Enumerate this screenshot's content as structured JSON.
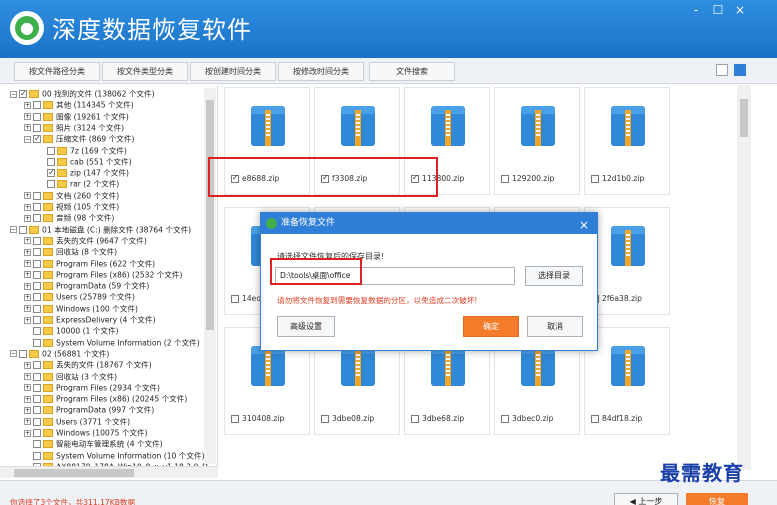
{
  "app": {
    "title": "深度数据恢复软件",
    "window_controls": [
      "-",
      "☐",
      "×"
    ]
  },
  "tabs": [
    {
      "label": "按文件路径分类"
    },
    {
      "label": "按文件类型分类"
    },
    {
      "label": "按创建时间分类"
    },
    {
      "label": "按修改时间分类"
    },
    {
      "label": "文件搜索"
    }
  ],
  "view_icons": [
    "list-view-icon",
    "grid-view-icon"
  ],
  "tree": {
    "rows": [
      {
        "indent": 0,
        "exp": "−",
        "checked": true,
        "folder": true,
        "label": "00 找到的文件 (138062 个文件)"
      },
      {
        "indent": 1,
        "exp": "+",
        "checked": false,
        "folder": true,
        "label": "其他  (114345 个文件)"
      },
      {
        "indent": 1,
        "exp": "+",
        "checked": false,
        "folder": true,
        "label": "图像  (19261 个文件)"
      },
      {
        "indent": 1,
        "exp": "+",
        "checked": false,
        "folder": true,
        "label": "照片  (3124 个文件)"
      },
      {
        "indent": 1,
        "exp": "−",
        "checked": true,
        "folder": true,
        "label": "压缩文件  (869 个文件)"
      },
      {
        "indent": 2,
        "exp": "",
        "checked": false,
        "folder": true,
        "label": "7z  (169 个文件)"
      },
      {
        "indent": 2,
        "exp": "",
        "checked": false,
        "folder": true,
        "label": "cab  (551 个文件)"
      },
      {
        "indent": 2,
        "exp": "",
        "checked": true,
        "folder": true,
        "label": "zip  (147 个文件)"
      },
      {
        "indent": 2,
        "exp": "",
        "checked": false,
        "folder": true,
        "label": "rar  (2 个文件)"
      },
      {
        "indent": 1,
        "exp": "+",
        "checked": false,
        "folder": true,
        "label": "文档  (260 个文件)"
      },
      {
        "indent": 1,
        "exp": "+",
        "checked": false,
        "folder": true,
        "label": "视频  (105 个文件)"
      },
      {
        "indent": 1,
        "exp": "+",
        "checked": false,
        "folder": true,
        "label": "音频  (98 个文件)"
      },
      {
        "indent": 0,
        "exp": "−",
        "checked": false,
        "folder": true,
        "label": "01 本地磁盘 (C:) 删除文件 (38764 个文件)"
      },
      {
        "indent": 1,
        "exp": "+",
        "checked": false,
        "folder": true,
        "label": "丢失的文件  (9647 个文件)"
      },
      {
        "indent": 1,
        "exp": "+",
        "checked": false,
        "folder": true,
        "label": "回收站  (8 个文件)"
      },
      {
        "indent": 1,
        "exp": "+",
        "checked": false,
        "folder": true,
        "label": "Program Files  (622 个文件)"
      },
      {
        "indent": 1,
        "exp": "+",
        "checked": false,
        "folder": true,
        "label": "Program Files (x86)  (2532 个文件)"
      },
      {
        "indent": 1,
        "exp": "+",
        "checked": false,
        "folder": true,
        "label": "ProgramData  (59 个文件)"
      },
      {
        "indent": 1,
        "exp": "+",
        "checked": false,
        "folder": true,
        "label": "Users  (25789 个文件)"
      },
      {
        "indent": 1,
        "exp": "+",
        "checked": false,
        "folder": true,
        "label": "Windows  (100 个文件)"
      },
      {
        "indent": 1,
        "exp": "+",
        "checked": false,
        "folder": true,
        "label": "ExpressDelivery  (4 个文件)"
      },
      {
        "indent": 1,
        "exp": "",
        "checked": false,
        "folder": true,
        "label": "10000  (1 个文件)"
      },
      {
        "indent": 1,
        "exp": "",
        "checked": false,
        "folder": true,
        "label": "System Volume Information  (2 个文件)"
      },
      {
        "indent": 0,
        "exp": "−",
        "checked": false,
        "folder": true,
        "label": "02  (56881 个文件)"
      },
      {
        "indent": 1,
        "exp": "+",
        "checked": false,
        "folder": true,
        "label": "丢失的文件  (18767 个文件)"
      },
      {
        "indent": 1,
        "exp": "+",
        "checked": false,
        "folder": true,
        "label": "回收站  (3 个文件)"
      },
      {
        "indent": 1,
        "exp": "+",
        "checked": false,
        "folder": true,
        "label": "Program Files  (2934 个文件)"
      },
      {
        "indent": 1,
        "exp": "+",
        "checked": false,
        "folder": true,
        "label": "Program Files (x86)  (20245 个文件)"
      },
      {
        "indent": 1,
        "exp": "+",
        "checked": false,
        "folder": true,
        "label": "ProgramData  (997 个文件)"
      },
      {
        "indent": 1,
        "exp": "+",
        "checked": false,
        "folder": true,
        "label": "Users  (3771 个文件)"
      },
      {
        "indent": 1,
        "exp": "+",
        "checked": false,
        "folder": true,
        "label": "Windows  (10075 个文件)"
      },
      {
        "indent": 1,
        "exp": "",
        "checked": false,
        "folder": true,
        "label": "智能电动车管理系统  (4 个文件)"
      },
      {
        "indent": 1,
        "exp": "",
        "checked": false,
        "folder": true,
        "label": "System Volume Information  (10 个文件)"
      },
      {
        "indent": 1,
        "exp": "",
        "checked": false,
        "folder": true,
        "label": "AX88179_178A_Win10_8_x_v1.18.2.0_D..."
      }
    ]
  },
  "files": [
    {
      "name": "e8688.zip",
      "checked": true
    },
    {
      "name": "f3308.zip",
      "checked": true
    },
    {
      "name": "113800.zip",
      "checked": true
    },
    {
      "name": "129200.zip",
      "checked": false
    },
    {
      "name": "12d1b0.zip",
      "checked": false
    },
    {
      "name": "14ed...",
      "checked": false
    },
    {
      "name": "",
      "checked": false
    },
    {
      "name": "",
      "checked": false
    },
    {
      "name": "",
      "checked": false
    },
    {
      "name": "2f6a38.zip",
      "checked": false
    },
    {
      "name": "310408.zip",
      "checked": false
    },
    {
      "name": "3dbe08.zip",
      "checked": false
    },
    {
      "name": "3dbe68.zip",
      "checked": false
    },
    {
      "name": "3dbec0.zip",
      "checked": false
    },
    {
      "name": "84df18.zip",
      "checked": false
    }
  ],
  "dialog": {
    "title": "准备恢复文件",
    "close": "×",
    "prompt": "请选择文件恢复后的保存目录!",
    "path_value": "D:\\tools\\桌面\\office",
    "browse_label": "选择目录",
    "warning": "请勿将文件恢复到需要恢复数据的分区，以免造成二次破坏!",
    "advanced_label": "高级设置",
    "ok_label": "确定",
    "cancel_label": "取消"
  },
  "footer": {
    "status": "你选择了3个文件，共311.17KB数据",
    "prev_label": "◀ 上一步",
    "recover_label": "恢复"
  },
  "watermark": "最需教育",
  "colors": {
    "titlebar": "#2f8ee0",
    "accent": "#2f7fd8",
    "orange": "#f37b2a",
    "warning_red": "#e03a1e",
    "highlight_box": "#e02020"
  }
}
